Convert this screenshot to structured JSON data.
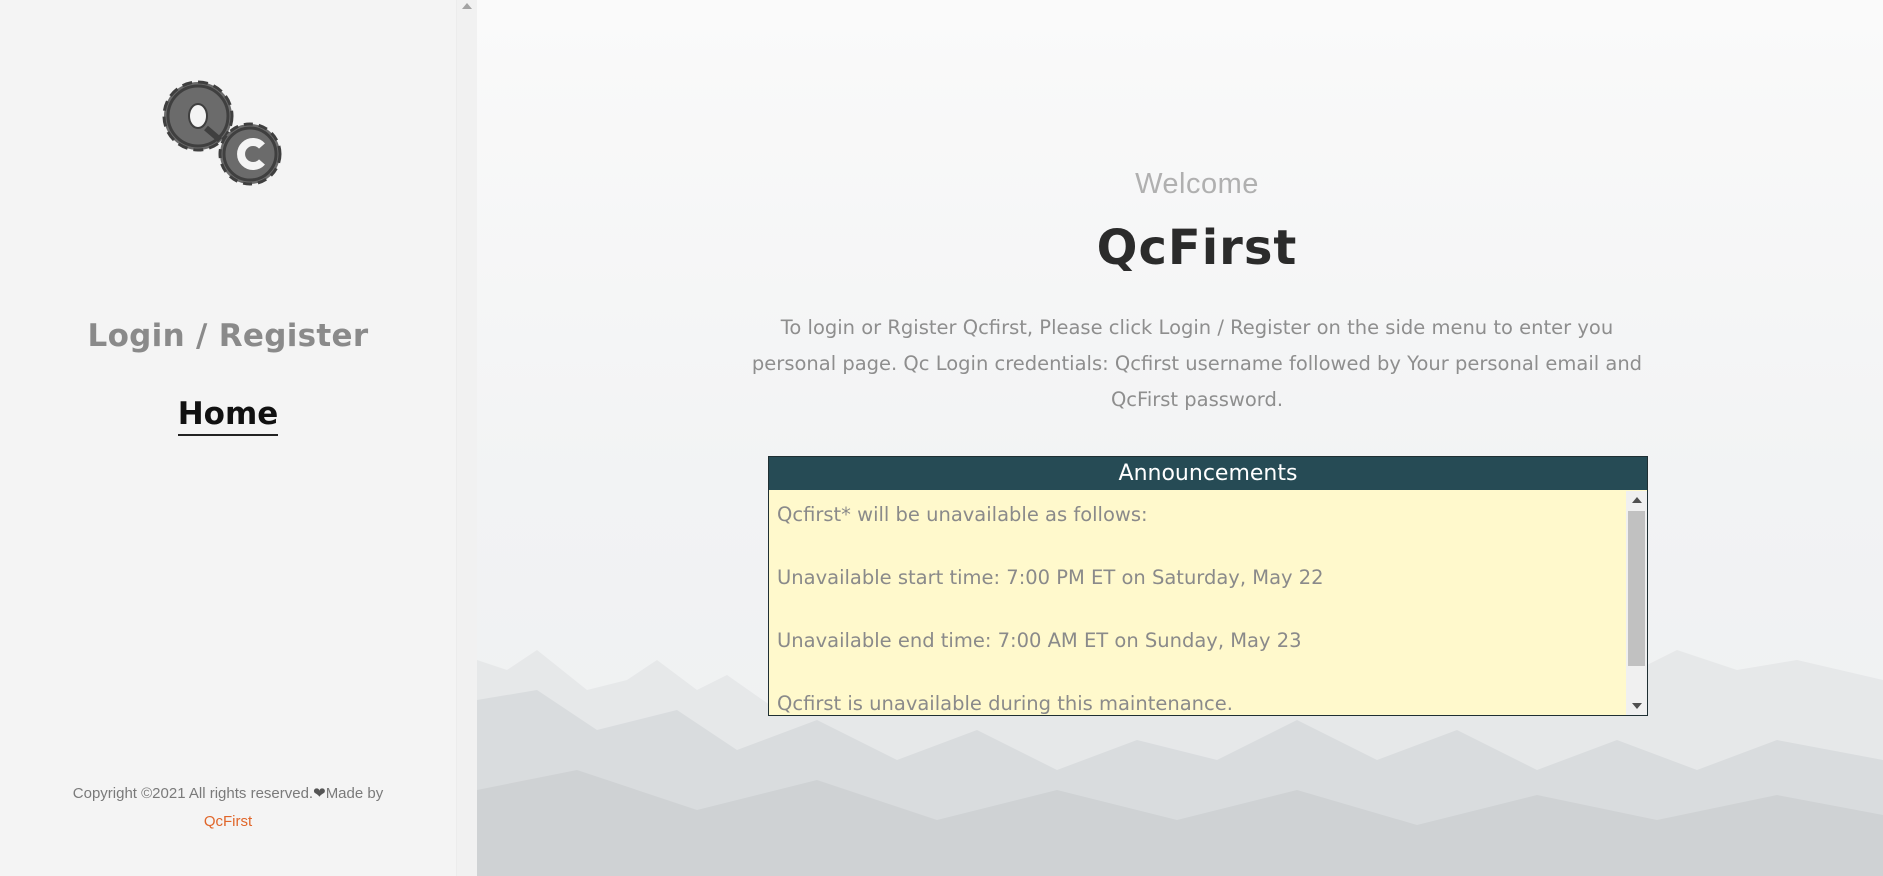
{
  "sidebar": {
    "logo_alt": "Qc",
    "nav": [
      {
        "label": "Login / Register"
      },
      {
        "label": "Home"
      }
    ],
    "copyright_text": "Copyright ©2021 All rights reserved.",
    "heart_glyph": "❤",
    "made_by": "Made by",
    "brand_link": "QcFirst"
  },
  "main": {
    "welcome": "Welcome",
    "title": "QcFirst",
    "intro": "To login or Rgister Qcfirst, Please click Login / Register on the side menu to enter you personal page. Qc Login credentials: Qcfirst username followed by Your personal email and QcFirst password.",
    "announcements": {
      "header": "Announcements",
      "lines": [
        "Qcfirst* will be unavailable as follows:",
        "Unavailable start time: 7:00 PM ET on Saturday, May 22",
        "Unavailable end time: 7:00 AM ET on Sunday, May 23",
        "Qcfirst is unavailable during this maintenance."
      ]
    }
  },
  "colors": {
    "sidebar_bg": "#f4f4f4",
    "announce_header_bg": "#264b55",
    "announce_body_bg": "#fff9cc",
    "brand_link": "#e0662a"
  }
}
